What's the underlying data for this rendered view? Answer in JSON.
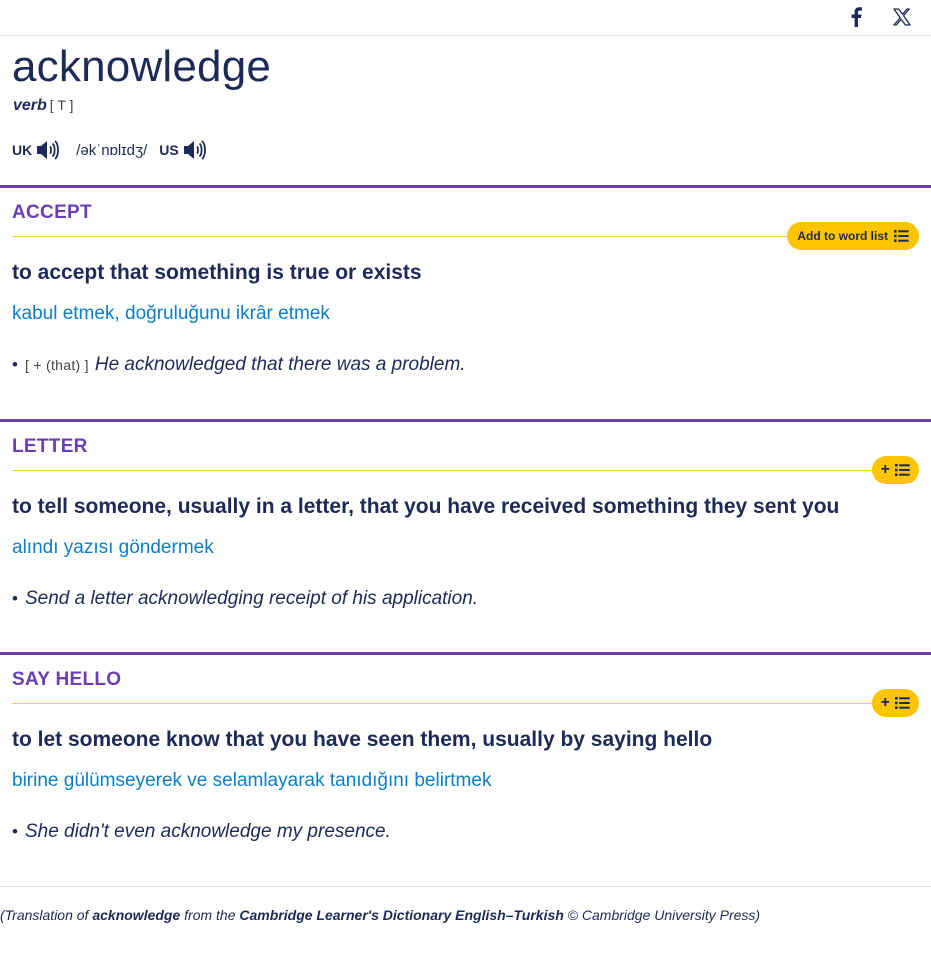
{
  "header": {
    "share_icons": [
      "facebook-icon",
      "x-icon"
    ]
  },
  "entry": {
    "headword": "acknowledge",
    "pos": "verb",
    "grammar": "[ T ]",
    "pron": {
      "uk_label": "UK",
      "us_label": "US",
      "ipa": "/əkˈnɒlɪdʒ/"
    }
  },
  "senses": [
    {
      "guideword": "ACCEPT",
      "add_label": "Add to word list",
      "definition": "to accept that something is true or exists",
      "translation": "kabul etmek, doğruluğunu ikrâr etmek",
      "example_gram": "[ + (that) ]",
      "example": "He acknowledged that there was a problem."
    },
    {
      "guideword": "LETTER",
      "add_short": "+",
      "definition": "to tell someone, usually in a letter, that you have received something they sent you",
      "translation": "alındı yazısı göndermek",
      "example": "Send a letter acknowledging receipt of his application."
    },
    {
      "guideword": "SAY HELLO",
      "add_short": "+",
      "definition": "to let someone know that you have seen them, usually by saying hello",
      "translation": "birine gülümseyerek ve selamlayarak tanıdığını belirtmek",
      "example": "She didn't even acknowledge my presence."
    }
  ],
  "footer": {
    "open": "(Translation of ",
    "word": "acknowledge",
    "mid": " from the ",
    "dict": "Cambridge Learner's Dictionary English–Turkish",
    "end": " © Cambridge University Press)"
  },
  "colors": {
    "headword": "#1d2a57",
    "guideword": "#6b3fb3",
    "translation": "#0c7ec9",
    "button": "#fec400"
  }
}
